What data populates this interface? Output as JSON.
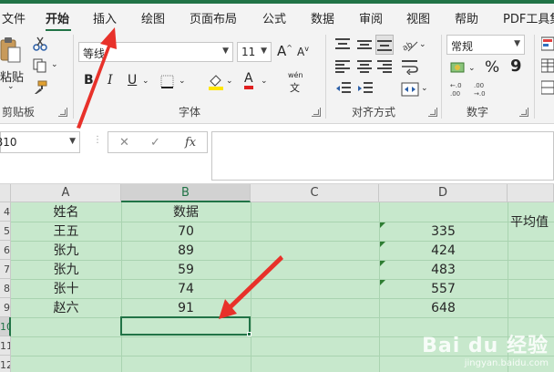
{
  "ribbon_tabs": [
    {
      "label": "文件"
    },
    {
      "label": "开始"
    },
    {
      "label": "插入"
    },
    {
      "label": "绘图"
    },
    {
      "label": "页面布局"
    },
    {
      "label": "公式"
    },
    {
      "label": "数据"
    },
    {
      "label": "审阅"
    },
    {
      "label": "视图"
    },
    {
      "label": "帮助"
    },
    {
      "label": "PDF工具集"
    }
  ],
  "active_tab": "开始",
  "clipboard": {
    "paste_label": "粘贴",
    "group_label": "剪贴板"
  },
  "font": {
    "name": "等线",
    "size": "11",
    "grow": "A",
    "shrink": "A",
    "bold": "B",
    "italic": "I",
    "underline": "U",
    "font_color_letter": "A",
    "phonetic": "wén",
    "group_label": "字体"
  },
  "alignment": {
    "group_label": "对齐方式"
  },
  "number": {
    "format": "常规",
    "percent": "%",
    "comma": "9",
    "group_label": "数字"
  },
  "formula_bar": {
    "name_box": "B10",
    "fx": "fx",
    "cancel": "✕",
    "enter": "✓",
    "formula": ""
  },
  "sheet": {
    "columns": [
      "A",
      "B",
      "C",
      "D"
    ],
    "rows": [
      "4",
      "5",
      "6",
      "7",
      "8",
      "9",
      "10",
      "11",
      "12"
    ],
    "header_row": {
      "A": "姓名",
      "B": "数据",
      "E": "平均值"
    },
    "data_rows": [
      {
        "A": "王五",
        "B": "70",
        "D": "335"
      },
      {
        "A": "张九",
        "B": "89",
        "D": "424"
      },
      {
        "A": "张九",
        "B": "59",
        "D": "483"
      },
      {
        "A": "张十",
        "B": "74",
        "D": "557"
      },
      {
        "A": "赵六",
        "B": "91",
        "D": "648"
      }
    ],
    "selected_cell": "B10"
  },
  "colors": {
    "excel_green": "#217346",
    "sheet_fill": "#c7e8cc",
    "annotation_red": "#e8312a"
  },
  "watermark": {
    "brand": "Bai du 经验",
    "url": "jingyan.baidu.com"
  }
}
